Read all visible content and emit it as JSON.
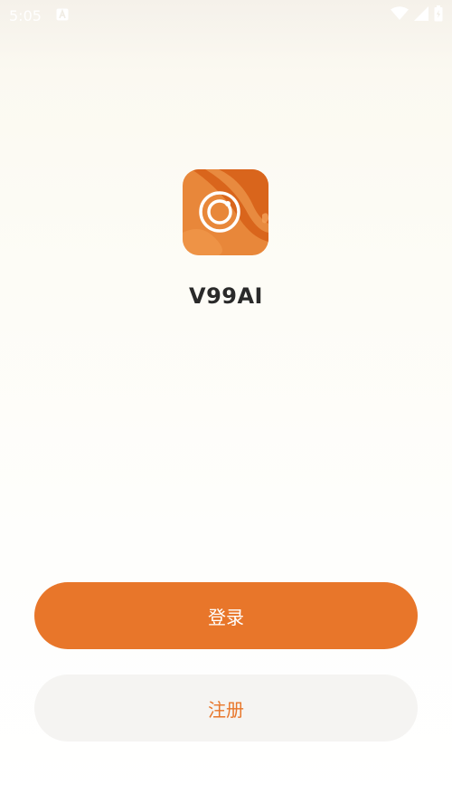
{
  "status_bar": {
    "time": "5:05",
    "icons": [
      "notification-a-icon",
      "wifi-icon",
      "cellular-signal-icon",
      "battery-icon"
    ]
  },
  "app": {
    "name": "V99AI",
    "logo": "camera-lens-logo"
  },
  "buttons": {
    "login_label": "登录",
    "register_label": "注册"
  },
  "colors": {
    "accent": "#e8762a",
    "register_bg": "#f5f4f2",
    "title_text": "#2a2a2a"
  }
}
